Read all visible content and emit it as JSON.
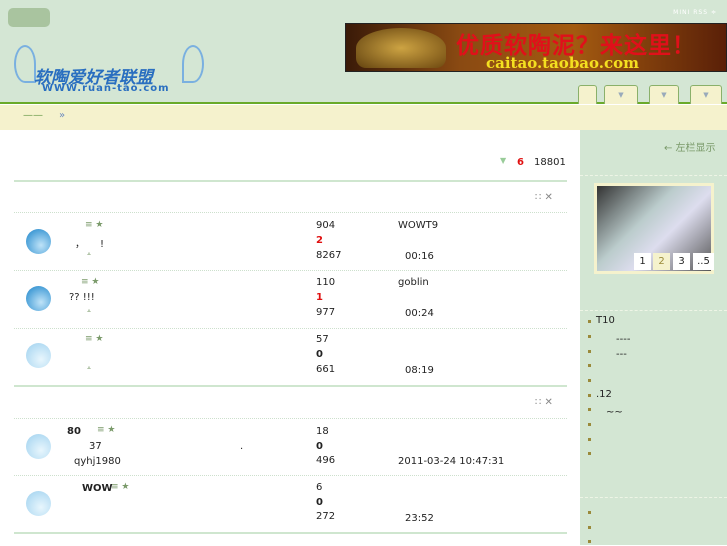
{
  "header": {
    "top_links": "MINI RSS ≑",
    "banner_text": "优质软陶泥？来这里！",
    "banner_url": "caitao.taobao.com",
    "logo_title": "软陶爱好者联盟",
    "logo_url": "WWW.ruan-tao.com",
    "tabs": [
      "",
      "▼",
      "▼",
      "▼"
    ]
  },
  "breadcrumb": {
    "home": "——",
    "sep": "»"
  },
  "main": {
    "summary": {
      "arrow": "▼",
      "count_red": "6",
      "total": "18801"
    },
    "section_tools": "∷ ✕",
    "rows": [
      {
        "icons": "≡ ★",
        "title": "，　　!",
        "sub": "⩡",
        "stat1": "904",
        "stat2": "2",
        "stat3": "8267",
        "last_user": "WOWT9",
        "last_time": "00:16"
      },
      {
        "icons": "≡ ★",
        "title": "??  !!!",
        "sub": "⩡",
        "stat1": "110",
        "stat2": "1",
        "stat3": "977",
        "last_user": "goblin",
        "last_time": "00:24"
      },
      {
        "icons": "≡ ★",
        "title": "",
        "sub": "⩡",
        "stat1": "57",
        "stat2": "0",
        "stat3": "661",
        "last_user": "",
        "last_time": "08:19"
      },
      {
        "name": "80",
        "icons": "≡ ★",
        "line2": "37",
        "mid": ".",
        "line3": "qyhj1980",
        "stat1": "18",
        "stat2": "0",
        "stat3": "496",
        "last_time": "2011-03-24 10:47:31"
      },
      {
        "name": "WOW",
        "icons": "≡ ★",
        "stat1": "6",
        "stat2": "0",
        "stat3": "272",
        "last_time": "23:52"
      }
    ]
  },
  "sidebar": {
    "toggle": "← 左栏显示",
    "pages": [
      "1",
      "2",
      "3",
      "..5"
    ],
    "list": [
      "T10",
      "　　----",
      "　　---",
      "",
      "",
      ".12",
      "　~~",
      "",
      "",
      ""
    ],
    "list2": [
      "",
      "",
      ""
    ]
  }
}
